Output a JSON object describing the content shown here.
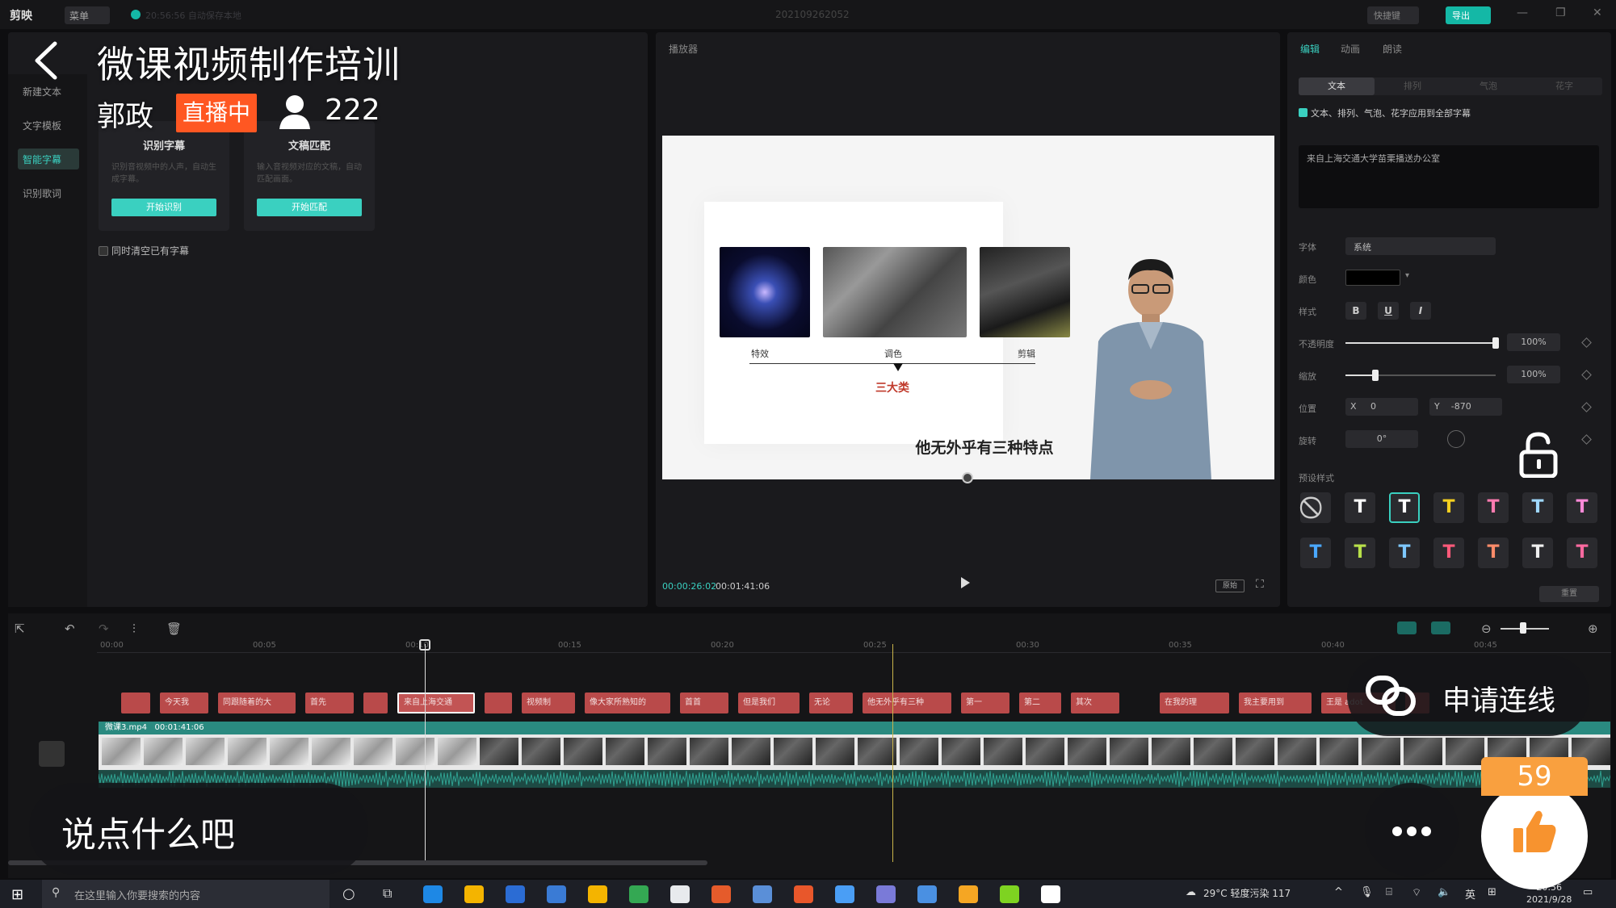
{
  "app": {
    "logo": "剪映",
    "menu": "菜单",
    "autosave": "20:56:56 自动保存本地",
    "project": "202109262052",
    "shortcut": "快捷键",
    "export": "导出"
  },
  "left_panel": {
    "nav": [
      "新建文本",
      "文字模板",
      "智能字幕",
      "识别歌词"
    ],
    "cards": [
      {
        "title": "识别字幕",
        "desc": "识别音视频中的人声，自动生成字幕。",
        "button": "开始识别"
      },
      {
        "title": "文稿匹配",
        "desc": "输入音视频对应的文稿，自动匹配画面。",
        "button": "开始匹配"
      }
    ],
    "clear_existing": "同时清空已有字幕"
  },
  "player": {
    "title": "播放器",
    "labels": [
      "特效",
      "调色",
      "剪辑"
    ],
    "category": "三大类",
    "subtitle": "他无外乎有三种特点",
    "time_current": "00:00:26:02",
    "time_total": "00:01:41:06",
    "ratio": "原始"
  },
  "inspector": {
    "tabs": [
      "编辑",
      "动画",
      "朗读"
    ],
    "subtabs": [
      "文本",
      "排列",
      "气泡",
      "花字"
    ],
    "apply_all": "文本、排列、气泡、花字应用到全部字幕",
    "text_value": "来自上海交通大学苗栗播送办公室",
    "font_label": "字体",
    "font_value": "系统",
    "color_label": "颜色",
    "style_label": "样式",
    "style_buttons": [
      "B",
      "U",
      "I"
    ],
    "opacity_label": "不透明度",
    "opacity_value": "100%",
    "opacity_level": 1.0,
    "scale_label": "缩放",
    "scale_value": "100%",
    "scale_level": 0.2,
    "position_label": "位置",
    "pos_x_label": "X",
    "pos_x": "0",
    "pos_y_label": "Y",
    "pos_y": "-870",
    "rotate_label": "旋转",
    "rotate_value": "0°",
    "preset_label": "预设样式",
    "reset": "重置",
    "presets": [
      {
        "glyph": "⃠",
        "color": "#cccccc"
      },
      {
        "glyph": "T",
        "color": "#ffffff"
      },
      {
        "glyph": "T",
        "color": "#ffffff"
      },
      {
        "glyph": "T",
        "color": "#f5d020"
      },
      {
        "glyph": "T",
        "color": "#ff7bb0"
      },
      {
        "glyph": "T",
        "color": "#9fd8ff"
      },
      {
        "glyph": "T",
        "color": "#ff8ad8"
      },
      {
        "glyph": "T",
        "color": "#4aa8ff"
      },
      {
        "glyph": "T",
        "color": "#b8e04a"
      },
      {
        "glyph": "T",
        "color": "#7ec8ff"
      },
      {
        "glyph": "T",
        "color": "#ff5a7a"
      },
      {
        "glyph": "T",
        "color": "#ff8c6a"
      },
      {
        "glyph": "T",
        "color": "#f0f0f0"
      },
      {
        "glyph": "T",
        "color": "#ff6aa0"
      }
    ]
  },
  "timeline": {
    "ruler": [
      "00:00",
      "00:05",
      "00:10",
      "00:15",
      "00:20",
      "00:25",
      "00:30",
      "00:35",
      "00:40",
      "00:45"
    ],
    "subtitle_clips": [
      "",
      "今天我",
      "同跟随着的大",
      "首先",
      "",
      "来自上海交通",
      "",
      "视频制",
      "像大家所熟知的",
      "首首",
      "但是我们",
      "无论",
      "他无外乎有三种",
      "第一",
      "第二",
      "其次",
      "在我的理",
      "我主要用到",
      "王是 adot",
      ""
    ],
    "video_name": "微课3.mp4",
    "video_duration": "00:01:41:06"
  },
  "taskbar": {
    "search": "在这里输入你要搜索的内容",
    "weather": "29°C 轻度污染 117",
    "ime": "英",
    "time": "20:56",
    "date": "2021/9/28"
  },
  "overlay": {
    "title": "微课视频制作培训",
    "host": "郭政",
    "live_badge": "直播中",
    "viewers": "222",
    "connect": "申请连线",
    "comment_placeholder": "说点什么吧",
    "likes": "59"
  }
}
